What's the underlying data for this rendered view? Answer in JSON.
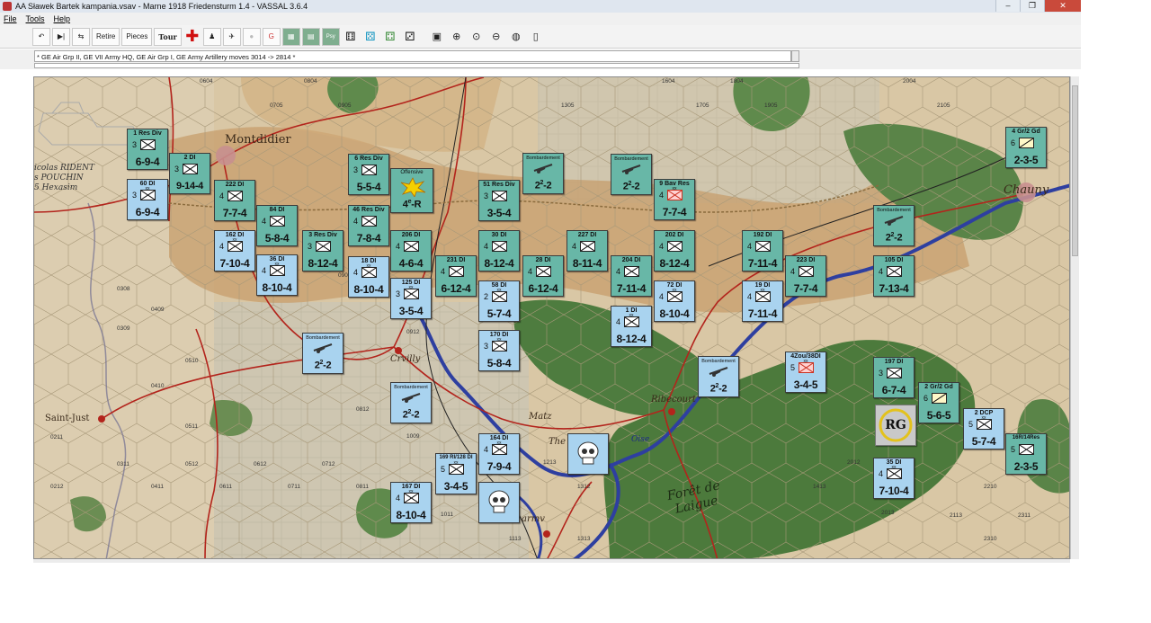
{
  "window": {
    "title": "AA Sławek Bartek kampania.vsav - Marne 1918 Friedensturm 1.4 - VASSAL 3.6.4",
    "min": "–",
    "max": "❐",
    "close": "✕"
  },
  "menu": [
    "File",
    "Tools",
    "Help"
  ],
  "toolbar": {
    "retire": "Retire",
    "pieces": "Pieces",
    "tour": "Tour",
    "psy": "Psy"
  },
  "chat": {
    "log": "* GE Air Grp II, GE VII Army HQ, GE Air Grp I, GE Army Artillery moves 3014 -> 2814 *"
  },
  "map": {
    "towns": [
      "Montdidier",
      "Chauny",
      "Crvilly",
      "Saint-Just",
      "Ribecourt",
      "Forêt de Laigue",
      "Matz",
      "Oise",
      "The",
      "armv"
    ],
    "credits": [
      "icolas RIDENT",
      "s POUCHIN",
      "5 Hexasim"
    ],
    "hex_numbers": [
      "0604",
      "0705",
      "0804",
      "0905",
      "1305",
      "1604",
      "1705",
      "1804",
      "1905",
      "2004",
      "2105",
      "0808",
      "0908",
      "0510",
      "0511",
      "0410",
      "0409",
      "0308",
      "0309",
      "0211",
      "0212",
      "0311",
      "0411",
      "0512",
      "0611",
      "0612",
      "0711",
      "0712",
      "0811",
      "0812",
      "0911",
      "0912",
      "1009",
      "1011",
      "1113",
      "1213",
      "1312",
      "1313",
      "1413",
      "2012",
      "2013",
      "2113",
      "2210",
      "2211",
      "2310",
      "2311"
    ]
  },
  "counters": {
    "light": [
      {
        "unit": "60 DI",
        "size": "3",
        "str": "6-9-4"
      },
      {
        "unit": "162 DI",
        "size": "4",
        "str": "7-10-4"
      },
      {
        "unit": "36 DI",
        "size": "4",
        "str": "8-10-4"
      },
      {
        "unit": "18 DI",
        "size": "4",
        "str": "8-10-4"
      },
      {
        "unit": "125 DI",
        "size": "3",
        "str": "3-5-4"
      },
      {
        "unit": "58 DI",
        "size": "2",
        "str": "5-7-4"
      },
      {
        "unit": "170 DI",
        "size": "3",
        "str": "5-8-4"
      },
      {
        "unit": "1 DI",
        "size": "4",
        "str": "8-12-4"
      },
      {
        "unit": "72 DI",
        "size": "4",
        "str": "8-10-4"
      },
      {
        "unit": "19 DI",
        "size": "4",
        "str": "7-11-4"
      },
      {
        "unit": "4Zou/38DI",
        "size": "5",
        "str": "3-4-5"
      },
      {
        "unit": "2 DCP",
        "size": "5",
        "str": "5-7-4"
      },
      {
        "unit": "35 DI",
        "size": "4",
        "str": "7-10-4"
      },
      {
        "unit": "164 DI",
        "size": "4",
        "str": "7-9-4"
      },
      {
        "unit": "169 RI/128 DI",
        "size": "5",
        "str": "3-4-5"
      },
      {
        "unit": "167 DI",
        "size": "4",
        "str": "8-10-4"
      },
      {
        "unit": "9 Bav Res",
        "size": "4",
        "str": "7-7-4"
      }
    ],
    "dark": [
      {
        "unit": "1 Res Div",
        "size": "3",
        "str": "6-9-4"
      },
      {
        "unit": "2 DI",
        "size": "3",
        "str": "9-14-4"
      },
      {
        "unit": "222 DI",
        "size": "4",
        "str": "7-7-4"
      },
      {
        "unit": "84 DI",
        "size": "4",
        "str": "5-8-4"
      },
      {
        "unit": "3 Res Div",
        "size": "3",
        "str": "8-12-4"
      },
      {
        "unit": "6 Res Div",
        "size": "3",
        "str": "5-5-4"
      },
      {
        "unit": "46 Res Div",
        "size": "4",
        "str": "7-8-4"
      },
      {
        "unit": "206 DI",
        "size": "4",
        "str": "4-6-4"
      },
      {
        "unit": "51 Res Div",
        "size": "3",
        "str": "3-5-4"
      },
      {
        "unit": "30 DI",
        "size": "4",
        "str": "8-12-4"
      },
      {
        "unit": "231 DI",
        "size": "4",
        "str": "6-12-4"
      },
      {
        "unit": "28 DI",
        "size": "4",
        "str": "6-12-4"
      },
      {
        "unit": "227 DI",
        "size": "4",
        "str": "8-11-4"
      },
      {
        "unit": "204 DI",
        "size": "4",
        "str": "7-11-4"
      },
      {
        "unit": "202 DI",
        "size": "4",
        "str": "8-12-4"
      },
      {
        "unit": "192 DI",
        "size": "4",
        "str": "7-11-4"
      },
      {
        "unit": "223 DI",
        "size": "4",
        "str": "7-7-4"
      },
      {
        "unit": "105 DI",
        "size": "4",
        "str": "7-13-4"
      },
      {
        "unit": "197 DI",
        "size": "3",
        "str": "6-7-4"
      },
      {
        "unit": "2 Gr/2 Gd",
        "size": "6",
        "str": "5-6-5"
      },
      {
        "unit": "4 Gr/2 Gd",
        "size": "6",
        "str": "2-3-5"
      },
      {
        "unit": "16R/14Res",
        "size": "5",
        "str": "2-3-5"
      }
    ],
    "bombardement_label": "Bombardement",
    "bombardement_value": "2",
    "bombardement_sup": "2",
    "offensive_label": "Offensive",
    "offensive_value": "4",
    "offensive_sup": "e",
    "offensive_suffix": "R",
    "rg_label": "RG"
  }
}
